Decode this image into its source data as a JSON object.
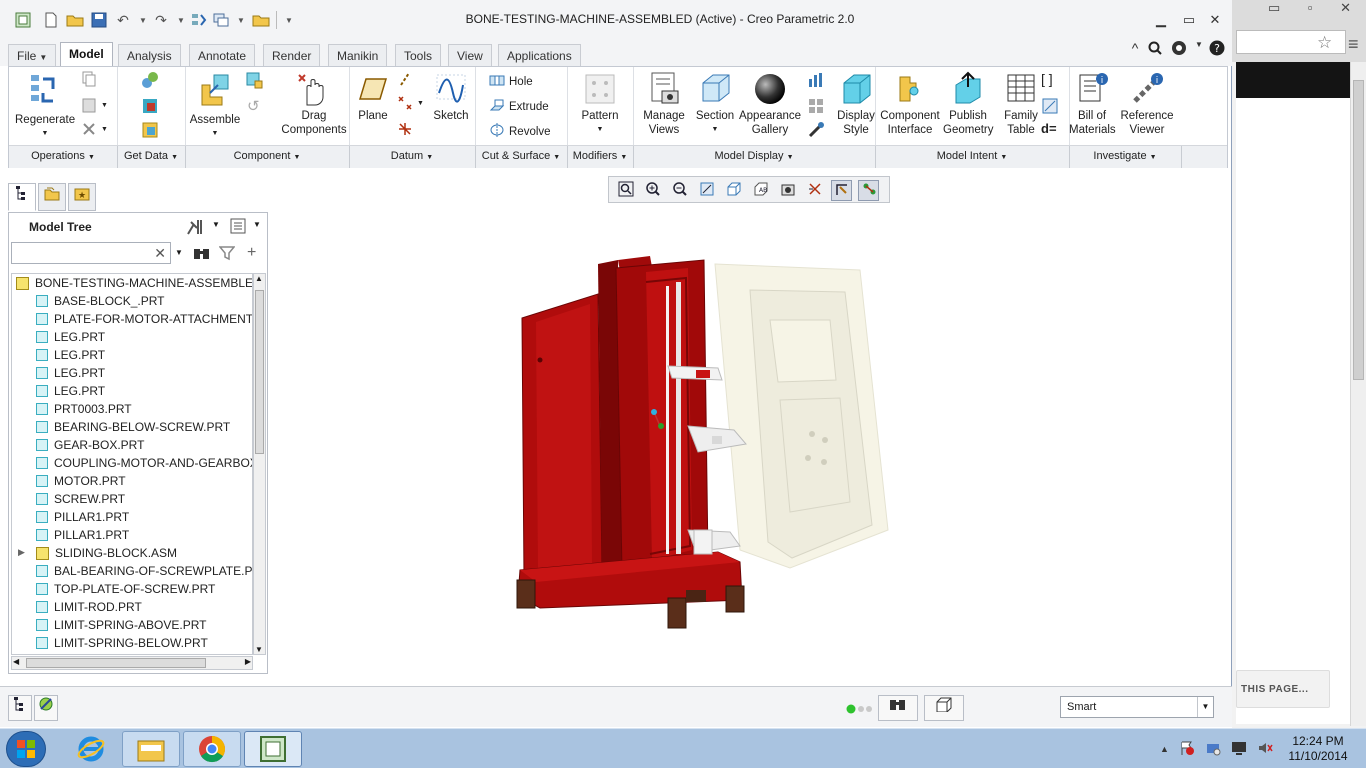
{
  "window": {
    "title": "BONE-TESTING-MACHINE-ASSEMBLED (Active) - Creo Parametric 2.0"
  },
  "ribbon_tabs": [
    {
      "label": "File",
      "active": false
    },
    {
      "label": "Model",
      "active": true
    },
    {
      "label": "Analysis",
      "active": false
    },
    {
      "label": "Annotate",
      "active": false
    },
    {
      "label": "Render",
      "active": false
    },
    {
      "label": "Manikin",
      "active": false
    },
    {
      "label": "Tools",
      "active": false
    },
    {
      "label": "View",
      "active": false
    },
    {
      "label": "Applications",
      "active": false
    }
  ],
  "ribbon": {
    "regenerate": "Regenerate",
    "assemble": "Assemble",
    "drag_components": "Drag\nComponents",
    "plane": "Plane",
    "sketch": "Sketch",
    "hole": "Hole",
    "extrude": "Extrude",
    "revolve": "Revolve",
    "pattern": "Pattern",
    "manage_views": "Manage\nViews",
    "section": "Section",
    "appearance_gallery": "Appearance\nGallery",
    "display_style": "Display\nStyle",
    "component_interface": "Component\nInterface",
    "publish_geometry": "Publish\nGeometry",
    "family_table": "Family\nTable",
    "bill_of_materials": "Bill of\nMaterials",
    "reference_viewer": "Reference\nViewer"
  },
  "ribbon_groups": [
    "Operations",
    "Get Data",
    "Component",
    "Datum",
    "Cut & Surface",
    "Modifiers",
    "Model Display",
    "Model Intent",
    "Investigate"
  ],
  "model_tree": {
    "title": "Model Tree",
    "search_value": "",
    "items": [
      {
        "label": "BONE-TESTING-MACHINE-ASSEMBLED",
        "type": "asm",
        "level": 0
      },
      {
        "label": "BASE-BLOCK_.PRT",
        "type": "prt",
        "level": 1
      },
      {
        "label": "PLATE-FOR-MOTOR-ATTACHMENT.PRT",
        "type": "prt",
        "level": 1
      },
      {
        "label": "LEG.PRT",
        "type": "prt",
        "level": 1
      },
      {
        "label": "LEG.PRT",
        "type": "prt",
        "level": 1
      },
      {
        "label": "LEG.PRT",
        "type": "prt",
        "level": 1
      },
      {
        "label": "LEG.PRT",
        "type": "prt",
        "level": 1
      },
      {
        "label": "PRT0003.PRT",
        "type": "prt",
        "level": 1
      },
      {
        "label": "BEARING-BELOW-SCREW.PRT",
        "type": "prt",
        "level": 1
      },
      {
        "label": "GEAR-BOX.PRT",
        "type": "prt",
        "level": 1
      },
      {
        "label": "COUPLING-MOTOR-AND-GEARBOX.PRT",
        "type": "prt",
        "level": 1
      },
      {
        "label": "MOTOR.PRT",
        "type": "prt",
        "level": 1
      },
      {
        "label": "SCREW.PRT",
        "type": "prt",
        "level": 1
      },
      {
        "label": "PILLAR1.PRT",
        "type": "prt",
        "level": 1
      },
      {
        "label": "PILLAR1.PRT",
        "type": "prt",
        "level": 1
      },
      {
        "label": "SLIDING-BLOCK.ASM",
        "type": "asm",
        "level": 1,
        "expandable": true
      },
      {
        "label": "BAL-BEARING-OF-SCREWPLATE.PRT",
        "type": "prt",
        "level": 1
      },
      {
        "label": "TOP-PLATE-OF-SCREW.PRT",
        "type": "prt",
        "level": 1
      },
      {
        "label": "LIMIT-ROD.PRT",
        "type": "prt",
        "level": 1
      },
      {
        "label": "LIMIT-SPRING-ABOVE.PRT",
        "type": "prt",
        "level": 1
      },
      {
        "label": "LIMIT-SPRING-BELOW.PRT",
        "type": "prt",
        "level": 1
      }
    ]
  },
  "statusbar": {
    "filter_value": "Smart"
  },
  "browser_bg": {
    "button_text": "THIS PAGE..."
  },
  "taskbar": {
    "time": "12:24 PM",
    "date": "11/10/2014"
  },
  "colors": {
    "machine_red": "#b00c0c",
    "machine_dark_red": "#7a0606",
    "door_ivory": "#f6f4e6",
    "legs": "#5a2e1a"
  }
}
